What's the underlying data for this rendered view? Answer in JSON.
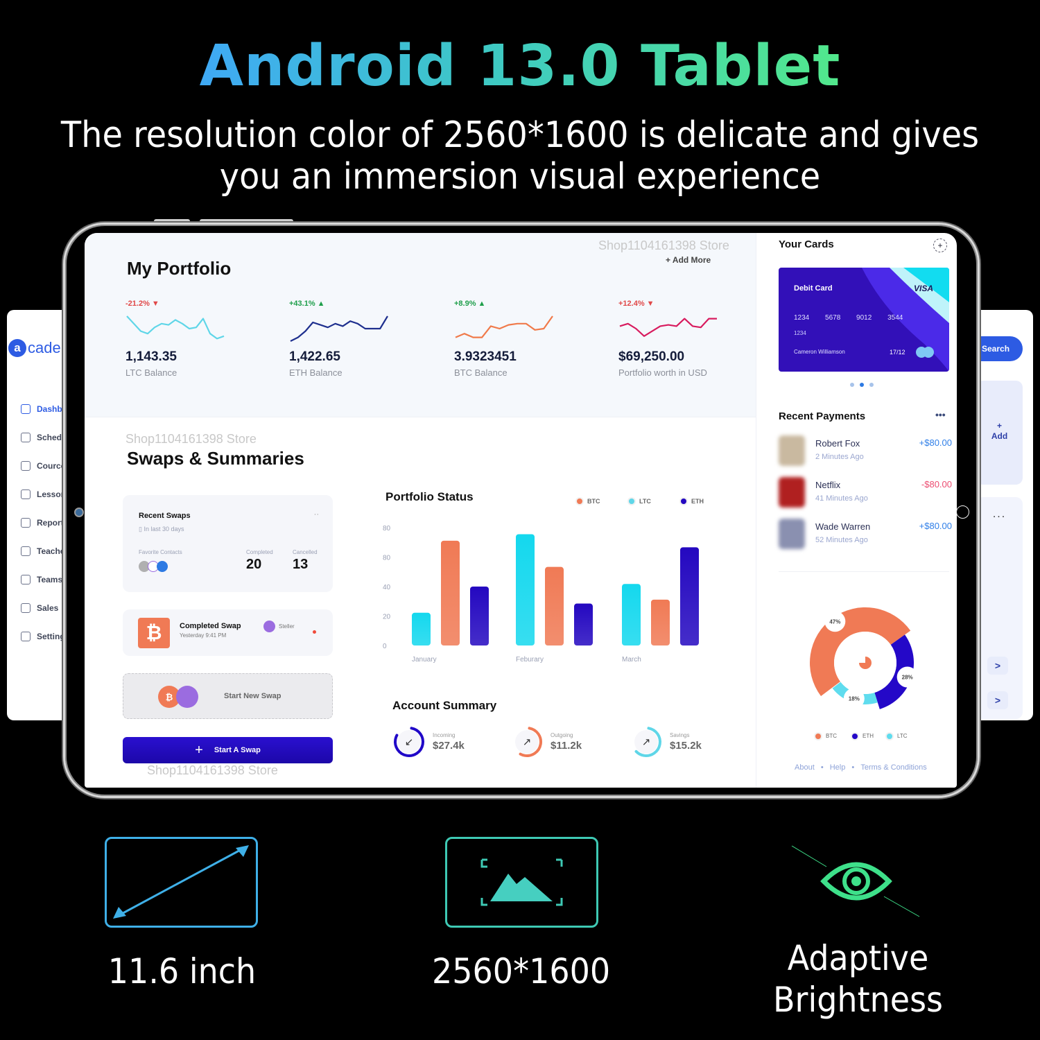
{
  "banner": {
    "headline": "Android 13.0 Tablet",
    "subline_1": "The resolution color of 2560*1600 is delicate and gives",
    "subline_2": "you an immersion visual experience"
  },
  "left_app": {
    "brand_logo": "a",
    "brand_text": "caden",
    "nav": [
      {
        "label": "Dashbo",
        "icon": "grid-icon",
        "active": true
      },
      {
        "label": "Schedu",
        "icon": "calendar-icon"
      },
      {
        "label": "Cource",
        "icon": "scan-icon"
      },
      {
        "label": "Lesson",
        "icon": "scan-icon"
      },
      {
        "label": "Reports",
        "icon": "document-icon"
      },
      {
        "label": "Teache",
        "icon": "user-icon"
      },
      {
        "label": "Teams",
        "icon": "users-icon"
      },
      {
        "label": "Sales",
        "icon": "dollar-icon"
      },
      {
        "label": "Setting",
        "icon": "gear-icon"
      }
    ]
  },
  "right_app": {
    "search_label": "Search",
    "add_plus": "+",
    "add_label": "Add",
    "more": "...",
    "chevron": ">"
  },
  "watermark": "Shop1104161398 Store",
  "portfolio": {
    "title": "My Portfolio",
    "add_more": "+ Add More",
    "coins": [
      {
        "change": "-21.2% ▼",
        "direction": "down",
        "value": "1,143.35",
        "label": "LTC Balance",
        "color": "#5fd6e8"
      },
      {
        "change": "+43.1% ▲",
        "direction": "up",
        "value": "1,422.65",
        "label": "ETH Balance",
        "color": "#1e2f8e"
      },
      {
        "change": "+8.9% ▲",
        "direction": "up",
        "value": "3.9323451",
        "label": "BTC Balance",
        "color": "#f07a4a"
      },
      {
        "change": "+12.4% ▼",
        "direction": "down",
        "value": "$69,250.00",
        "label": "Portfolio worth in USD",
        "color": "#d81b5e"
      }
    ]
  },
  "swaps": {
    "title": "Swaps & Summaries",
    "recent": {
      "title": "Recent Swaps",
      "subtitle": "In last 30 days",
      "more": "··",
      "favorites_label": "Favorite Contacts",
      "completed_label": "Completed",
      "completed_value": "20",
      "cancelled_label": "Cancelled",
      "cancelled_value": "13"
    },
    "completed_swap": {
      "symbol": "₿",
      "title": "Completed Swap",
      "time": "Yesterday 9:41 PM",
      "network": "Steller"
    },
    "new_swap": {
      "symbol": "₿",
      "label": "Start New Swap"
    },
    "start_button": {
      "plus": "+",
      "label": "Start A Swap"
    }
  },
  "chart_data": {
    "type": "bar",
    "title": "Portfolio Status",
    "categories": [
      "January",
      "Feburary",
      "March"
    ],
    "series": [
      {
        "name": "LTC",
        "values": [
          25,
          85,
          47
        ],
        "color": "#14d8ee"
      },
      {
        "name": "BTC",
        "values": [
          80,
          60,
          35
        ],
        "color": "#f07a55"
      },
      {
        "name": "ETH",
        "values": [
          45,
          32,
          75
        ],
        "color": "#2408c0"
      }
    ],
    "legend": [
      {
        "name": "BTC",
        "color": "#f07a55"
      },
      {
        "name": "LTC",
        "color": "#5fd6e8"
      },
      {
        "name": "ETH",
        "color": "#2408c0"
      }
    ],
    "yticks": [
      "0",
      "20",
      "40",
      "80",
      "80"
    ],
    "ylim": [
      0,
      80
    ],
    "xlabel": "",
    "ylabel": "",
    "legend_position": "top-right",
    "grid": false
  },
  "account_summary": {
    "title": "Account Summary",
    "items": [
      {
        "label": "Incoming",
        "value": "$27.4k",
        "arrow": "↙",
        "color": "#2008c8",
        "fraction": 0.8
      },
      {
        "label": "Outgoing",
        "value": "$11.2k",
        "arrow": "↗",
        "color": "#f07a55",
        "fraction": 0.55
      },
      {
        "label": "Savings",
        "value": "$15.2k",
        "arrow": "↗",
        "color": "#5fd6e8",
        "fraction": 0.6
      }
    ]
  },
  "cards": {
    "title": "Your Cards",
    "add": "+",
    "card_type": "Debit Card",
    "network": "VISA",
    "number": "1234 5678 9012 3544",
    "number_line2": "1234",
    "holder": "Cameron Williamson",
    "expiry": "17/12",
    "active_index": 1,
    "count": 3
  },
  "recent_payments": {
    "title": "Recent Payments",
    "more": "•••",
    "items": [
      {
        "name": "Robert Fox",
        "time": "2 Minutes Ago",
        "amount": "+$80.00",
        "sign": "pos",
        "avatar_color": "#c9b9a0"
      },
      {
        "name": "Netflix",
        "time": "41 Minutes Ago",
        "amount": "-$80.00",
        "sign": "neg",
        "avatar_color": "#b02020"
      },
      {
        "name": "Wade Warren",
        "time": "52 Minutes Ago",
        "amount": "+$80.00",
        "sign": "pos",
        "avatar_color": "#8a90b0"
      }
    ]
  },
  "allocation": {
    "slices": [
      {
        "name": "BTC",
        "percent": 47,
        "label": "47%",
        "color": "#f07a55"
      },
      {
        "name": "ETH",
        "percent": 28,
        "label": "28%",
        "color": "#2408c8"
      },
      {
        "name": "LTC",
        "percent": 18,
        "label": "18%",
        "color": "#5fdcee"
      }
    ]
  },
  "footer": {
    "about": "About",
    "help": "Help",
    "terms": "Terms & Conditions",
    "sep": "•"
  },
  "features": [
    {
      "label": "11.6 inch",
      "icon": "diagonal-arrow-icon",
      "color": "#3fb0e8"
    },
    {
      "label": "2560*1600",
      "icon": "image-frame-icon",
      "color": "#3ec9b4"
    },
    {
      "label_1": "Adaptive",
      "label_2": "Brightness",
      "icon": "eye-icon",
      "color": "#3ee08a"
    }
  ]
}
